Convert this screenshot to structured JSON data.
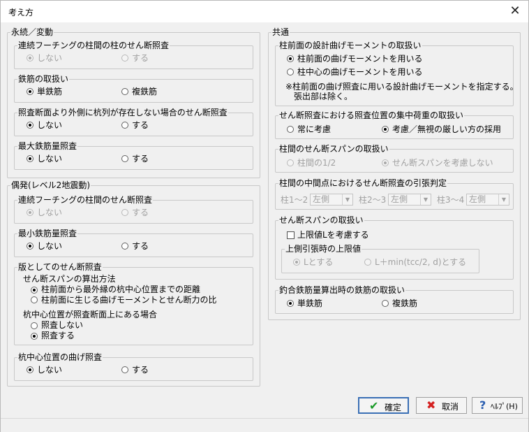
{
  "window": {
    "title": "考え方",
    "close_icon": "close-icon"
  },
  "g1": {
    "title": "永続／変動",
    "s1": {
      "title": "連続フーチングの柱間の柱のせん断照査",
      "opt1": "しない",
      "opt2": "する"
    },
    "s2": {
      "title": "鉄筋の取扱い",
      "opt1": "単鉄筋",
      "opt2": "複鉄筋"
    },
    "s3": {
      "title": "照査断面より外側に杭列が存在しない場合のせん断照査",
      "opt1": "しない",
      "opt2": "する"
    },
    "s4": {
      "title": "最大鉄筋量照査",
      "opt1": "しない",
      "opt2": "する"
    }
  },
  "g2": {
    "title": "偶発(レベル2地震動)",
    "s1": {
      "title": "連続フーチングの柱間のせん断照査",
      "opt1": "しない",
      "opt2": "する"
    },
    "s2": {
      "title": "最小鉄筋量照査",
      "opt1": "しない",
      "opt2": "する"
    },
    "s3": {
      "title": "版としてのせん断照査",
      "sub1": "せん断スパンの算出方法",
      "opt1": "柱前面から最外縁の杭中心位置までの距離",
      "opt2": "柱前面に生じる曲げモーメントとせん断力の比",
      "sub2": "杭中心位置が照査断面上にある場合",
      "opt3": "照査しない",
      "opt4": "照査する"
    },
    "s4": {
      "title": "杭中心位置の曲げ照査",
      "opt1": "しない",
      "opt2": "する"
    }
  },
  "g3": {
    "title": "共通",
    "s1": {
      "title": "柱前面の設計曲げモーメントの取扱い",
      "opt1": "柱前面の曲げモーメントを用いる",
      "opt2": "柱中心の曲げモーメントを用いる",
      "note1": "※柱前面の曲げ照査に用いる設計曲げモーメントを指定する。",
      "note2": "張出部は除く。"
    },
    "s2": {
      "title": "せん断照査における照査位置の集中荷重の取扱い",
      "opt1": "常に考慮",
      "opt2": "考慮／無視の厳しい方の採用"
    },
    "s3": {
      "title": "柱間のせん断スパンの取扱い",
      "opt1": "柱間の1/2",
      "opt2": "せん断スパンを考慮しない"
    },
    "s4": {
      "title": "柱間の中間点におけるせん断照査の引張判定",
      "l1": "柱1～2",
      "v1": "左側",
      "l2": "柱2～3",
      "v2": "左側",
      "l3": "柱3～4",
      "v3": "左側"
    },
    "s5": {
      "title": "せん断スパンの取扱い",
      "check": "上限値Lを考慮する",
      "sub": "上側引張時の上限値",
      "opt1": "Lとする",
      "opt2": "L＋min(tcc/2, d)とする"
    },
    "s6": {
      "title": "釣合鉄筋量算出時の鉄筋の取扱い",
      "opt1": "単鉄筋",
      "opt2": "複鉄筋"
    }
  },
  "buttons": {
    "ok": "確定",
    "ok_icon": "checkmark-icon",
    "cancel": "取消",
    "cancel_icon": "x-icon",
    "help": "ﾍﾙﾌﾟ(H)",
    "help_icon": "question-icon"
  }
}
